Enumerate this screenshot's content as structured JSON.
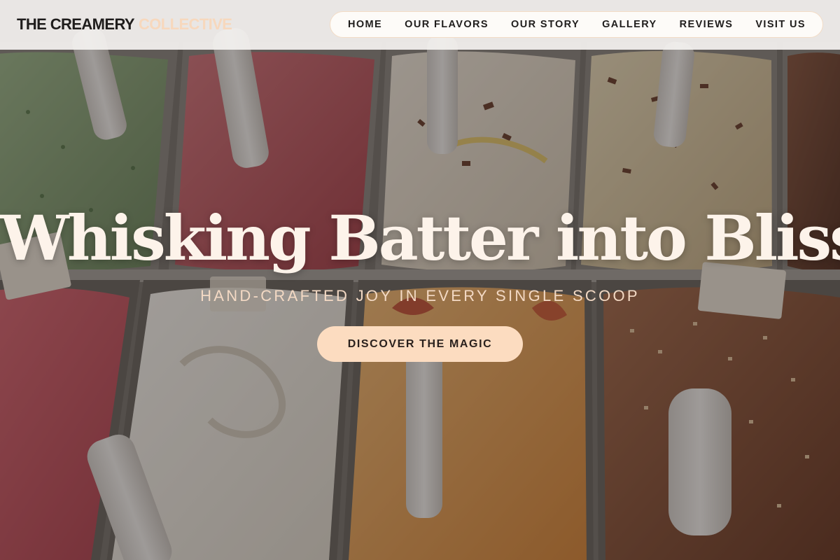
{
  "brand": {
    "name_main": "THE CREAMERY",
    "name_accent": "COLLECTIVE"
  },
  "nav": {
    "items": [
      {
        "label": "HOME"
      },
      {
        "label": "OUR FLAVORS"
      },
      {
        "label": "OUR STORY"
      },
      {
        "label": "GALLERY"
      },
      {
        "label": "REVIEWS"
      },
      {
        "label": "VISIT US"
      }
    ]
  },
  "hero": {
    "title": "Whisking Batter into Bliss",
    "subtitle": "HAND-CRAFTED JOY IN EVERY SINGLE SCOOP",
    "cta_label": "DISCOVER THE MAGIC",
    "background": "gelato-display-case-photo"
  },
  "colors": {
    "header_bg": "#f4f2f0",
    "brand_accent": "#f7d8bd",
    "cta_bg": "#fcdcc0",
    "title_text": "#fdf3ea",
    "subtitle_text": "#f3d9c4"
  }
}
